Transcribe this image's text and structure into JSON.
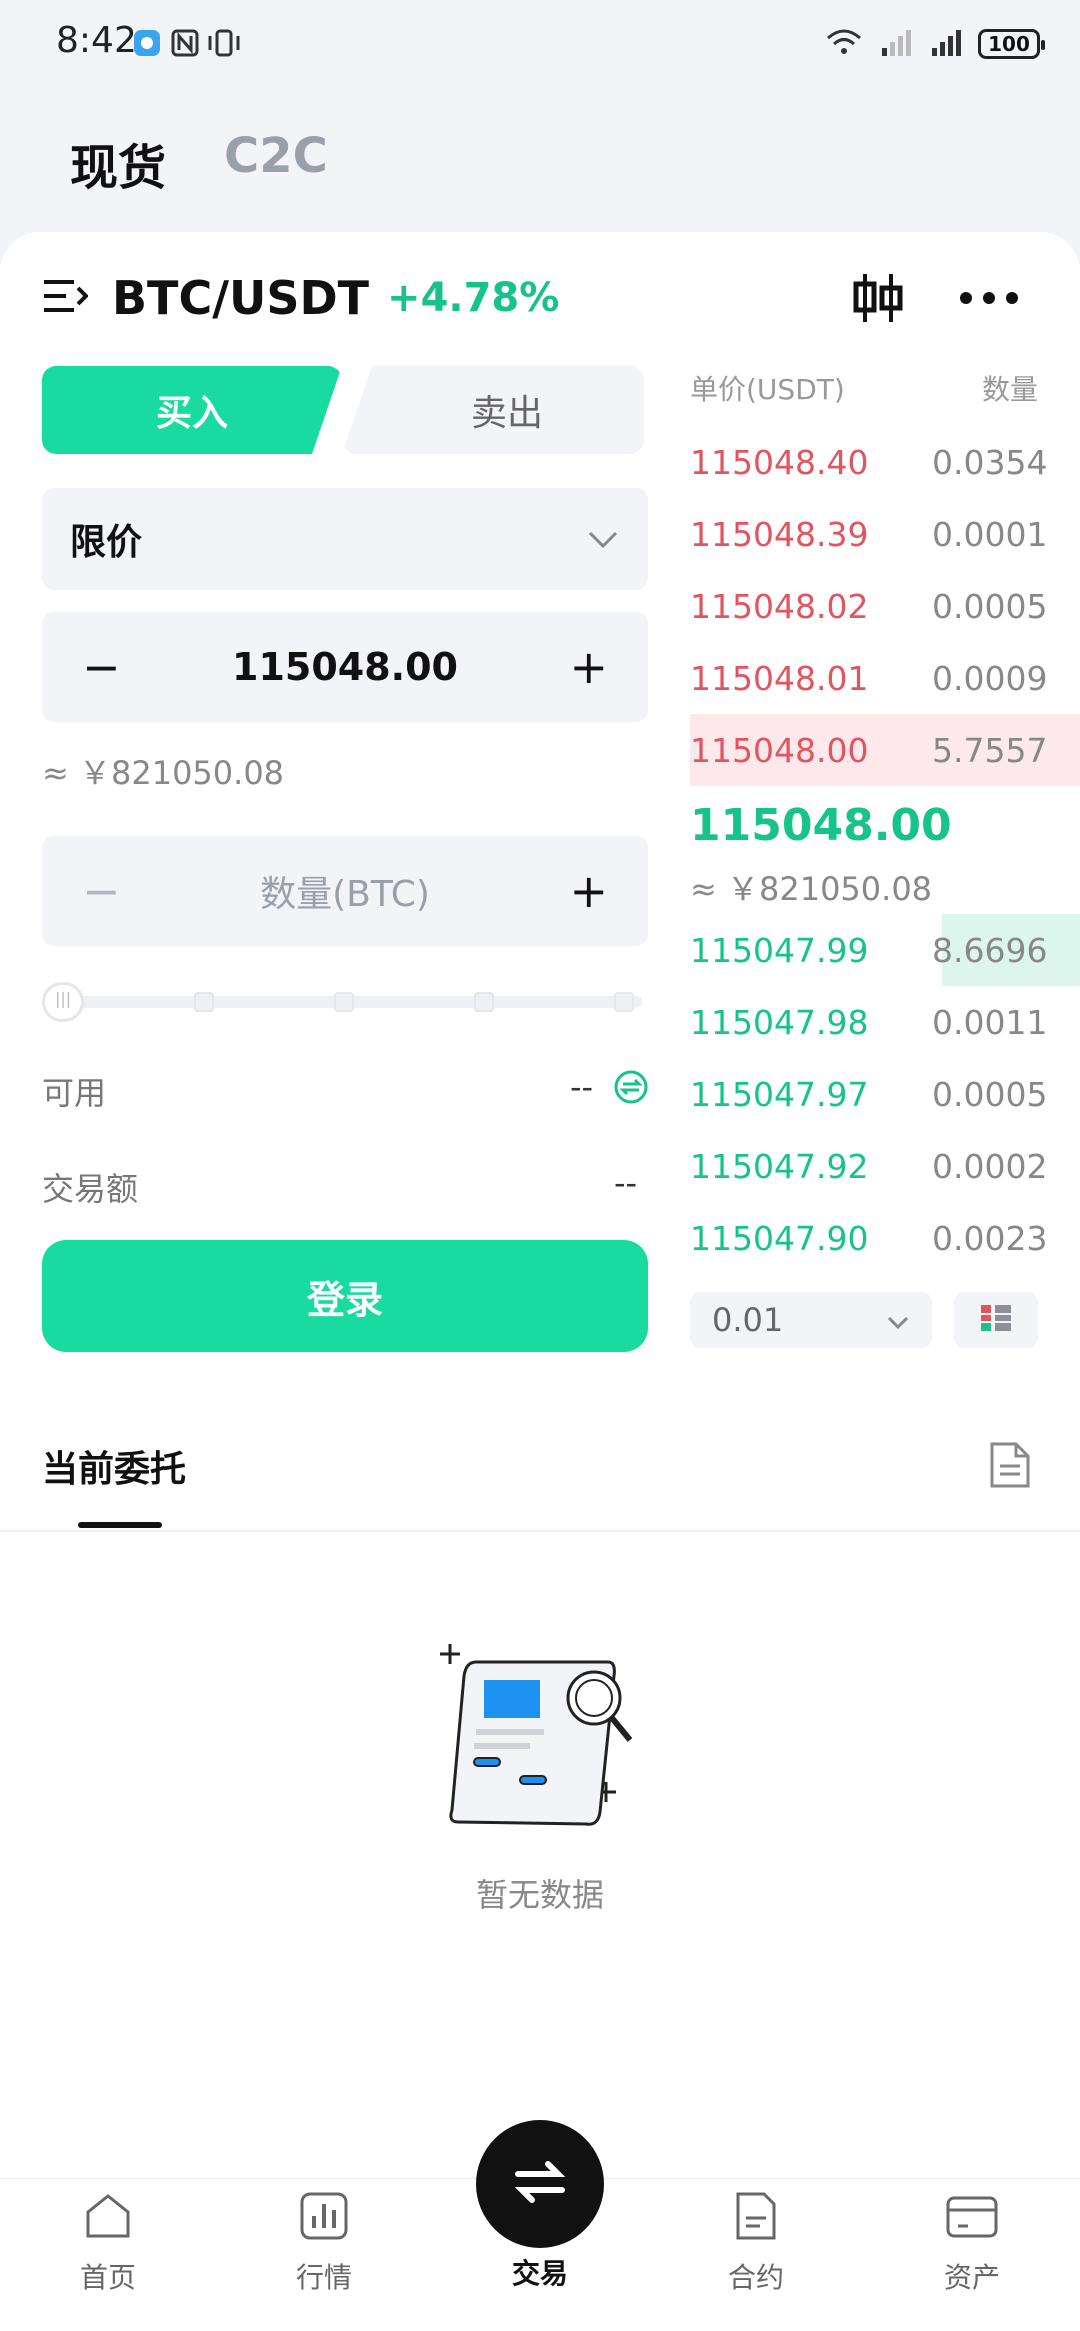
{
  "status_bar": {
    "time": "8:42",
    "battery": "100"
  },
  "top_tabs": {
    "spot": "现货",
    "c2c": "C2C"
  },
  "pair": {
    "name": "BTC/USDT",
    "change": "+4.78%"
  },
  "trade_tabs": {
    "buy": "买入",
    "sell": "卖出"
  },
  "order_type": "限价",
  "price_input": {
    "value": "115048.00"
  },
  "approx_cny": "≈ ￥821050.08",
  "quantity_input": {
    "placeholder": "数量(BTC)"
  },
  "available": {
    "label": "可用",
    "value": "--"
  },
  "trade_amount": {
    "label": "交易额",
    "value": "--"
  },
  "login_button": "登录",
  "order_book": {
    "header_price": "单价(USDT)",
    "header_qty": "数量",
    "asks": [
      {
        "price": "115048.40",
        "qty": "0.0354"
      },
      {
        "price": "115048.39",
        "qty": "0.0001"
      },
      {
        "price": "115048.02",
        "qty": "0.0005"
      },
      {
        "price": "115048.01",
        "qty": "0.0009"
      },
      {
        "price": "115048.00",
        "qty": "5.7557"
      }
    ],
    "last_price": "115048.00",
    "last_price_cny": "≈ ￥821050.08",
    "bids": [
      {
        "price": "115047.99",
        "qty": "8.6696"
      },
      {
        "price": "115047.98",
        "qty": "0.0011"
      },
      {
        "price": "115047.97",
        "qty": "0.0005"
      },
      {
        "price": "115047.92",
        "qty": "0.0002"
      },
      {
        "price": "115047.90",
        "qty": "0.0023"
      }
    ],
    "depth_precision": "0.01"
  },
  "orders": {
    "title": "当前委托",
    "empty_text": "暂无数据"
  },
  "bottom_nav": [
    {
      "label": "首页",
      "icon": "home-icon"
    },
    {
      "label": "行情",
      "icon": "market-icon"
    },
    {
      "label": "交易",
      "icon": "trade-icon"
    },
    {
      "label": "合约",
      "icon": "contract-icon"
    },
    {
      "label": "资产",
      "icon": "wallet-icon"
    }
  ],
  "colors": {
    "green": "#19dba0",
    "red": "#e05560"
  }
}
